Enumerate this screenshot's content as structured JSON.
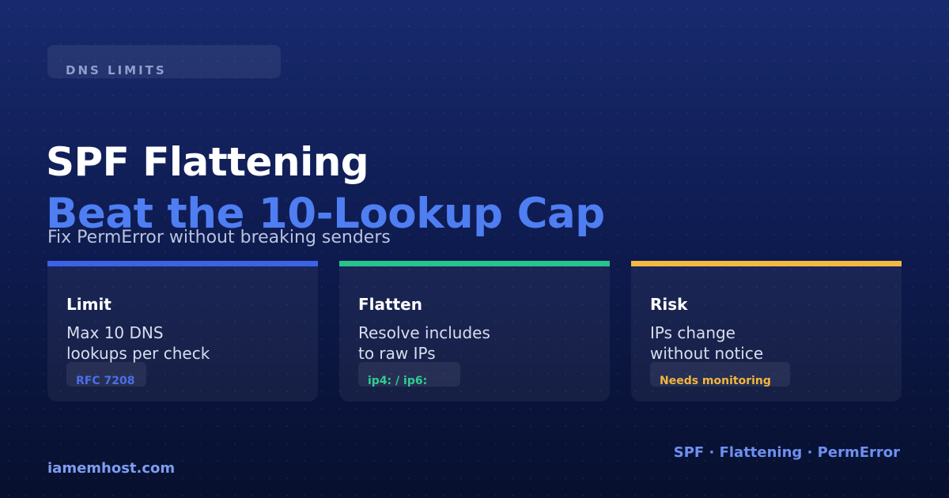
{
  "badge": {
    "label": "DNS LIMITS"
  },
  "hero": {
    "title": "SPF Flattening",
    "subtitle": "Beat the 10-Lookup Cap",
    "tagline": "Fix PermError without breaking senders"
  },
  "cards": [
    {
      "title": "Limit",
      "text_line1": "Max 10 DNS",
      "text_line2": "lookups per check",
      "chip": "RFC 7208",
      "accent": "#3b63e6",
      "chip_color": "#4b6fe8"
    },
    {
      "title": "Flatten",
      "text_line1": "Resolve includes",
      "text_line2": "to raw IPs",
      "chip": "ip4: / ip6:",
      "accent": "#25c48a",
      "chip_color": "#2fcf8e"
    },
    {
      "title": "Risk",
      "text_line1": "IPs change",
      "text_line2": "without notice",
      "chip": "Needs monitoring",
      "accent": "#f5b942",
      "chip_color": "#f2b540"
    }
  ],
  "footer": {
    "site": "iamemhost.com",
    "tags": "SPF · Flattening · PermError"
  },
  "colors": {
    "brand_blue": "#4e7ef2",
    "background": "#0f1c52"
  }
}
